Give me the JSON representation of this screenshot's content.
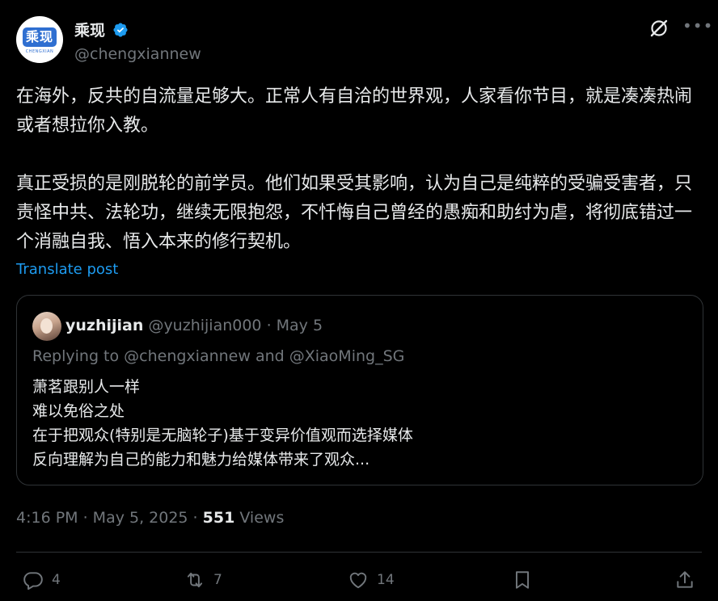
{
  "author": {
    "display_name": "乘现",
    "handle": "@chengxiannew",
    "avatar_logo_text": "乘现",
    "avatar_logo_sub": "CHENGXIAN"
  },
  "post": {
    "text": "在海外，反共的自流量足够大。正常人有自洽的世界观，人家看你节目，就是凑凑热闹或者想拉你入教。\n\n真正受损的是刚脱轮的前学员。他们如果受其影响，认为自己是纯粹的受骗受害者，只责怪中共、法轮功，继续无限抱怨，不忏悔自己曾经的愚痴和助纣为虐，将彻底错过一个消融自我、悟入本来的修行契机。",
    "translate_label": "Translate post"
  },
  "quote": {
    "name": "yuzhijian",
    "handle_date": "@yuzhijian000 · May 5",
    "replying": "Replying to @chengxiannew and @XiaoMing_SG",
    "text": "萧茗跟别人一样\n难以免俗之处\n在于把观众(特别是无脑轮子)基于变异价值观而选择媒体\n反向理解为自己的能力和魅力给媒体带来了观众..."
  },
  "meta": {
    "timestamp": "4:16 PM · May 5, 2025 · ",
    "views_count": "551",
    "views_label": " Views"
  },
  "actions": {
    "replies": "4",
    "reposts": "7",
    "likes": "14"
  },
  "colors": {
    "background": "#000000",
    "text": "#e7e9ea",
    "secondary": "#71767b",
    "accent": "#1d9bf0",
    "border": "#2f3336"
  },
  "icons": [
    "verified-badge-icon",
    "grok-icon",
    "more-icon",
    "reply-icon",
    "repost-icon",
    "like-icon",
    "bookmark-icon",
    "share-icon"
  ]
}
